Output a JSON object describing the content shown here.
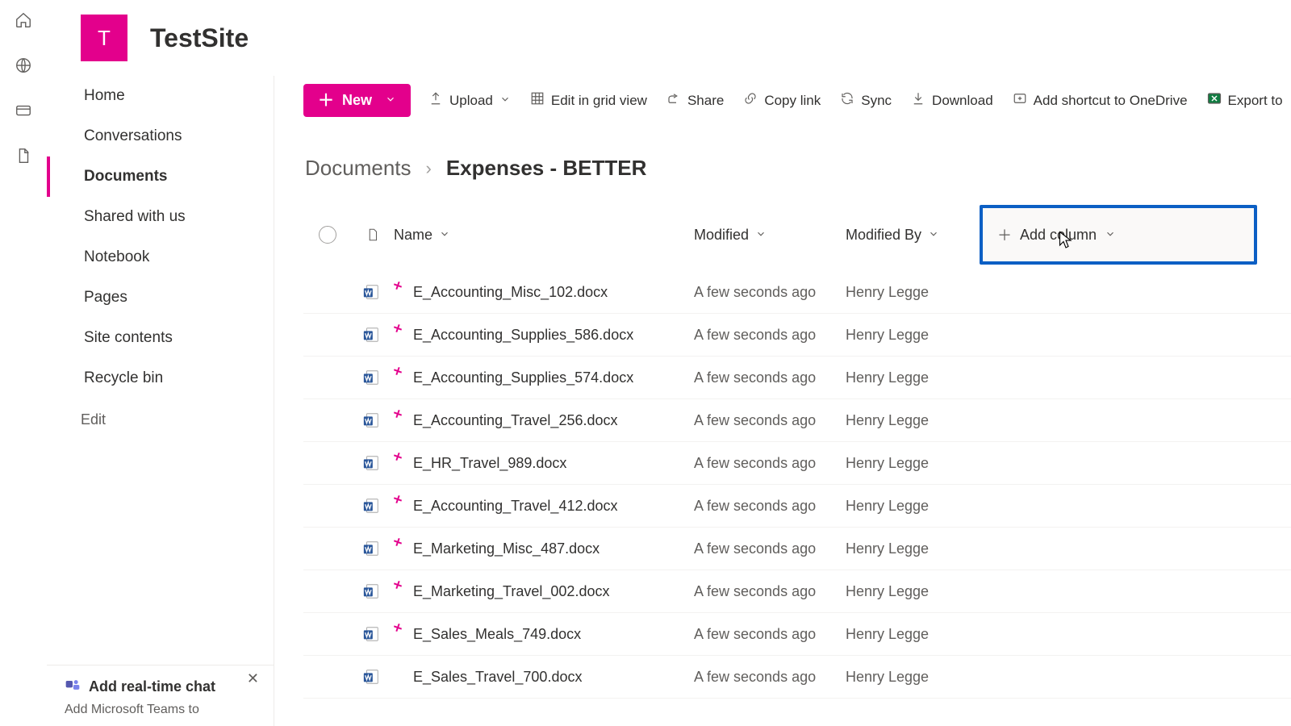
{
  "site": {
    "logo_letter": "T",
    "title": "TestSite"
  },
  "rail": {
    "items": [
      "home",
      "globe",
      "card",
      "doc"
    ]
  },
  "sidebar": {
    "items": [
      {
        "label": "Home"
      },
      {
        "label": "Conversations"
      },
      {
        "label": "Documents",
        "active": true
      },
      {
        "label": "Shared with us"
      },
      {
        "label": "Notebook"
      },
      {
        "label": "Pages"
      },
      {
        "label": "Site contents"
      },
      {
        "label": "Recycle bin"
      }
    ],
    "edit_label": "Edit"
  },
  "promo": {
    "title": "Add real-time chat",
    "body": "Add Microsoft Teams to"
  },
  "toolbar": {
    "new_label": "New",
    "items": [
      {
        "icon": "upload",
        "label": "Upload",
        "chev": true
      },
      {
        "icon": "grid",
        "label": "Edit in grid view"
      },
      {
        "icon": "share",
        "label": "Share"
      },
      {
        "icon": "link",
        "label": "Copy link"
      },
      {
        "icon": "sync",
        "label": "Sync"
      },
      {
        "icon": "download",
        "label": "Download"
      },
      {
        "icon": "shortcut",
        "label": "Add shortcut to OneDrive"
      },
      {
        "icon": "excel",
        "label": "Export to"
      }
    ]
  },
  "breadcrumb": {
    "root": "Documents",
    "leaf": "Expenses - BETTER"
  },
  "columns": {
    "name": "Name",
    "modified": "Modified",
    "modified_by": "Modified By",
    "add": "Add column"
  },
  "files": [
    {
      "name": "E_Accounting_Misc_102.docx",
      "modified": "A few seconds ago",
      "by": "Henry Legge",
      "new": true
    },
    {
      "name": "E_Accounting_Supplies_586.docx",
      "modified": "A few seconds ago",
      "by": "Henry Legge",
      "new": true
    },
    {
      "name": "E_Accounting_Supplies_574.docx",
      "modified": "A few seconds ago",
      "by": "Henry Legge",
      "new": true
    },
    {
      "name": "E_Accounting_Travel_256.docx",
      "modified": "A few seconds ago",
      "by": "Henry Legge",
      "new": true
    },
    {
      "name": "E_HR_Travel_989.docx",
      "modified": "A few seconds ago",
      "by": "Henry Legge",
      "new": true
    },
    {
      "name": "E_Accounting_Travel_412.docx",
      "modified": "A few seconds ago",
      "by": "Henry Legge",
      "new": true
    },
    {
      "name": "E_Marketing_Misc_487.docx",
      "modified": "A few seconds ago",
      "by": "Henry Legge",
      "new": true
    },
    {
      "name": "E_Marketing_Travel_002.docx",
      "modified": "A few seconds ago",
      "by": "Henry Legge",
      "new": true
    },
    {
      "name": "E_Sales_Meals_749.docx",
      "modified": "A few seconds ago",
      "by": "Henry Legge",
      "new": true
    },
    {
      "name": "E_Sales_Travel_700.docx",
      "modified": "A few seconds ago",
      "by": "Henry Legge",
      "new": false
    }
  ]
}
